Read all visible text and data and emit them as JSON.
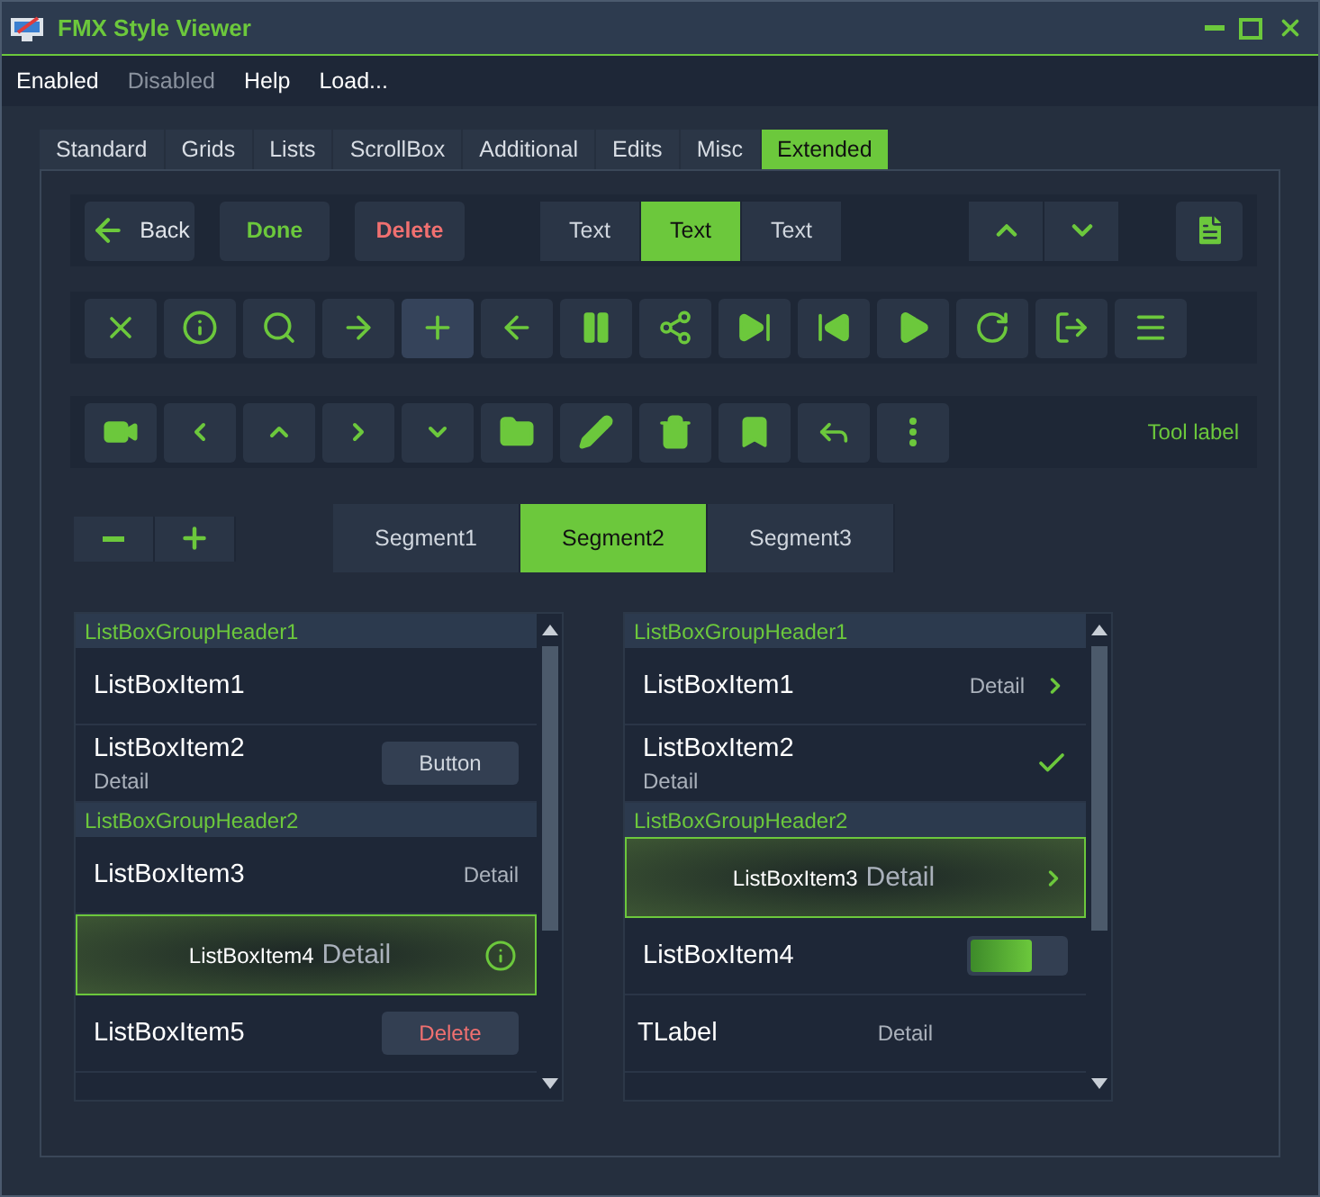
{
  "window": {
    "title": "FMX Style Viewer"
  },
  "menu": [
    {
      "label": "Enabled",
      "disabled": false
    },
    {
      "label": "Disabled",
      "disabled": true
    },
    {
      "label": "Help",
      "disabled": false
    },
    {
      "label": "Load...",
      "disabled": false
    }
  ],
  "tabs": [
    {
      "label": "Standard",
      "selected": false
    },
    {
      "label": "Grids",
      "selected": false
    },
    {
      "label": "Lists",
      "selected": false
    },
    {
      "label": "ScrollBox",
      "selected": false
    },
    {
      "label": "Additional",
      "selected": false
    },
    {
      "label": "Edits",
      "selected": false
    },
    {
      "label": "Misc",
      "selected": false
    },
    {
      "label": "Extended",
      "selected": true
    }
  ],
  "action_buttons": [
    {
      "kind": "back",
      "label": "Back"
    },
    {
      "kind": "done",
      "label": "Done"
    },
    {
      "kind": "delete",
      "label": "Delete"
    }
  ],
  "text_segments": [
    {
      "label": "Text",
      "selected": false
    },
    {
      "label": "Text",
      "selected": true
    },
    {
      "label": "Text",
      "selected": false
    }
  ],
  "icon_toolbar": {
    "buttons": [
      {
        "highlighted": false
      },
      {
        "highlighted": false
      },
      {
        "highlighted": false
      },
      {
        "highlighted": false
      },
      {
        "highlighted": true
      },
      {
        "highlighted": false
      },
      {
        "highlighted": false
      },
      {
        "highlighted": false
      },
      {
        "highlighted": false
      },
      {
        "highlighted": false
      },
      {
        "highlighted": false
      },
      {
        "highlighted": false
      },
      {
        "highlighted": false
      },
      {
        "highlighted": false
      }
    ]
  },
  "tool_toolbar": {
    "buttons": [
      {
        "highlighted": false
      },
      {
        "highlighted": false
      },
      {
        "highlighted": false
      },
      {
        "highlighted": false
      },
      {
        "highlighted": false
      },
      {
        "highlighted": false
      },
      {
        "highlighted": false
      },
      {
        "highlighted": false
      },
      {
        "highlighted": false
      },
      {
        "highlighted": false
      },
      {
        "highlighted": false
      }
    ],
    "label": "Tool label"
  },
  "segments": [
    {
      "label": "Segment1",
      "selected": false
    },
    {
      "label": "Segment2",
      "selected": true
    },
    {
      "label": "Segment3",
      "selected": false
    }
  ],
  "list_left": [
    {
      "kind": "header",
      "text": "ListBoxGroupHeader1"
    },
    {
      "kind": "plain",
      "text": "ListBoxItem1",
      "selected": false
    },
    {
      "kind": "subtitle_button",
      "text": "ListBoxItem2",
      "detail": "Detail",
      "button": "Button",
      "selected": false
    },
    {
      "kind": "header",
      "text": "ListBoxGroupHeader2"
    },
    {
      "kind": "right_detail",
      "text": "ListBoxItem3",
      "detail": "Detail",
      "selected": false
    },
    {
      "kind": "inline_detail_info",
      "text": "ListBoxItem4",
      "detail": "Detail",
      "selected": true
    },
    {
      "kind": "delete_button",
      "text": "ListBoxItem5",
      "button": "Delete",
      "selected": false
    }
  ],
  "list_right": [
    {
      "kind": "header",
      "text": "ListBoxGroupHeader1"
    },
    {
      "kind": "right_detail_chevron",
      "text": "ListBoxItem1",
      "detail": "Detail",
      "selected": false
    },
    {
      "kind": "subtitle_check",
      "text": "ListBoxItem2",
      "detail": "Detail",
      "selected": false
    },
    {
      "kind": "header",
      "text": "ListBoxGroupHeader2"
    },
    {
      "kind": "inline_detail_chevron",
      "text": "ListBoxItem3",
      "detail": "Detail",
      "selected": true
    },
    {
      "kind": "switch",
      "text": "ListBoxItem4",
      "on": true,
      "selected": false
    },
    {
      "kind": "label_detail",
      "text": "TLabel",
      "detail": "Detail",
      "selected": false
    }
  ]
}
